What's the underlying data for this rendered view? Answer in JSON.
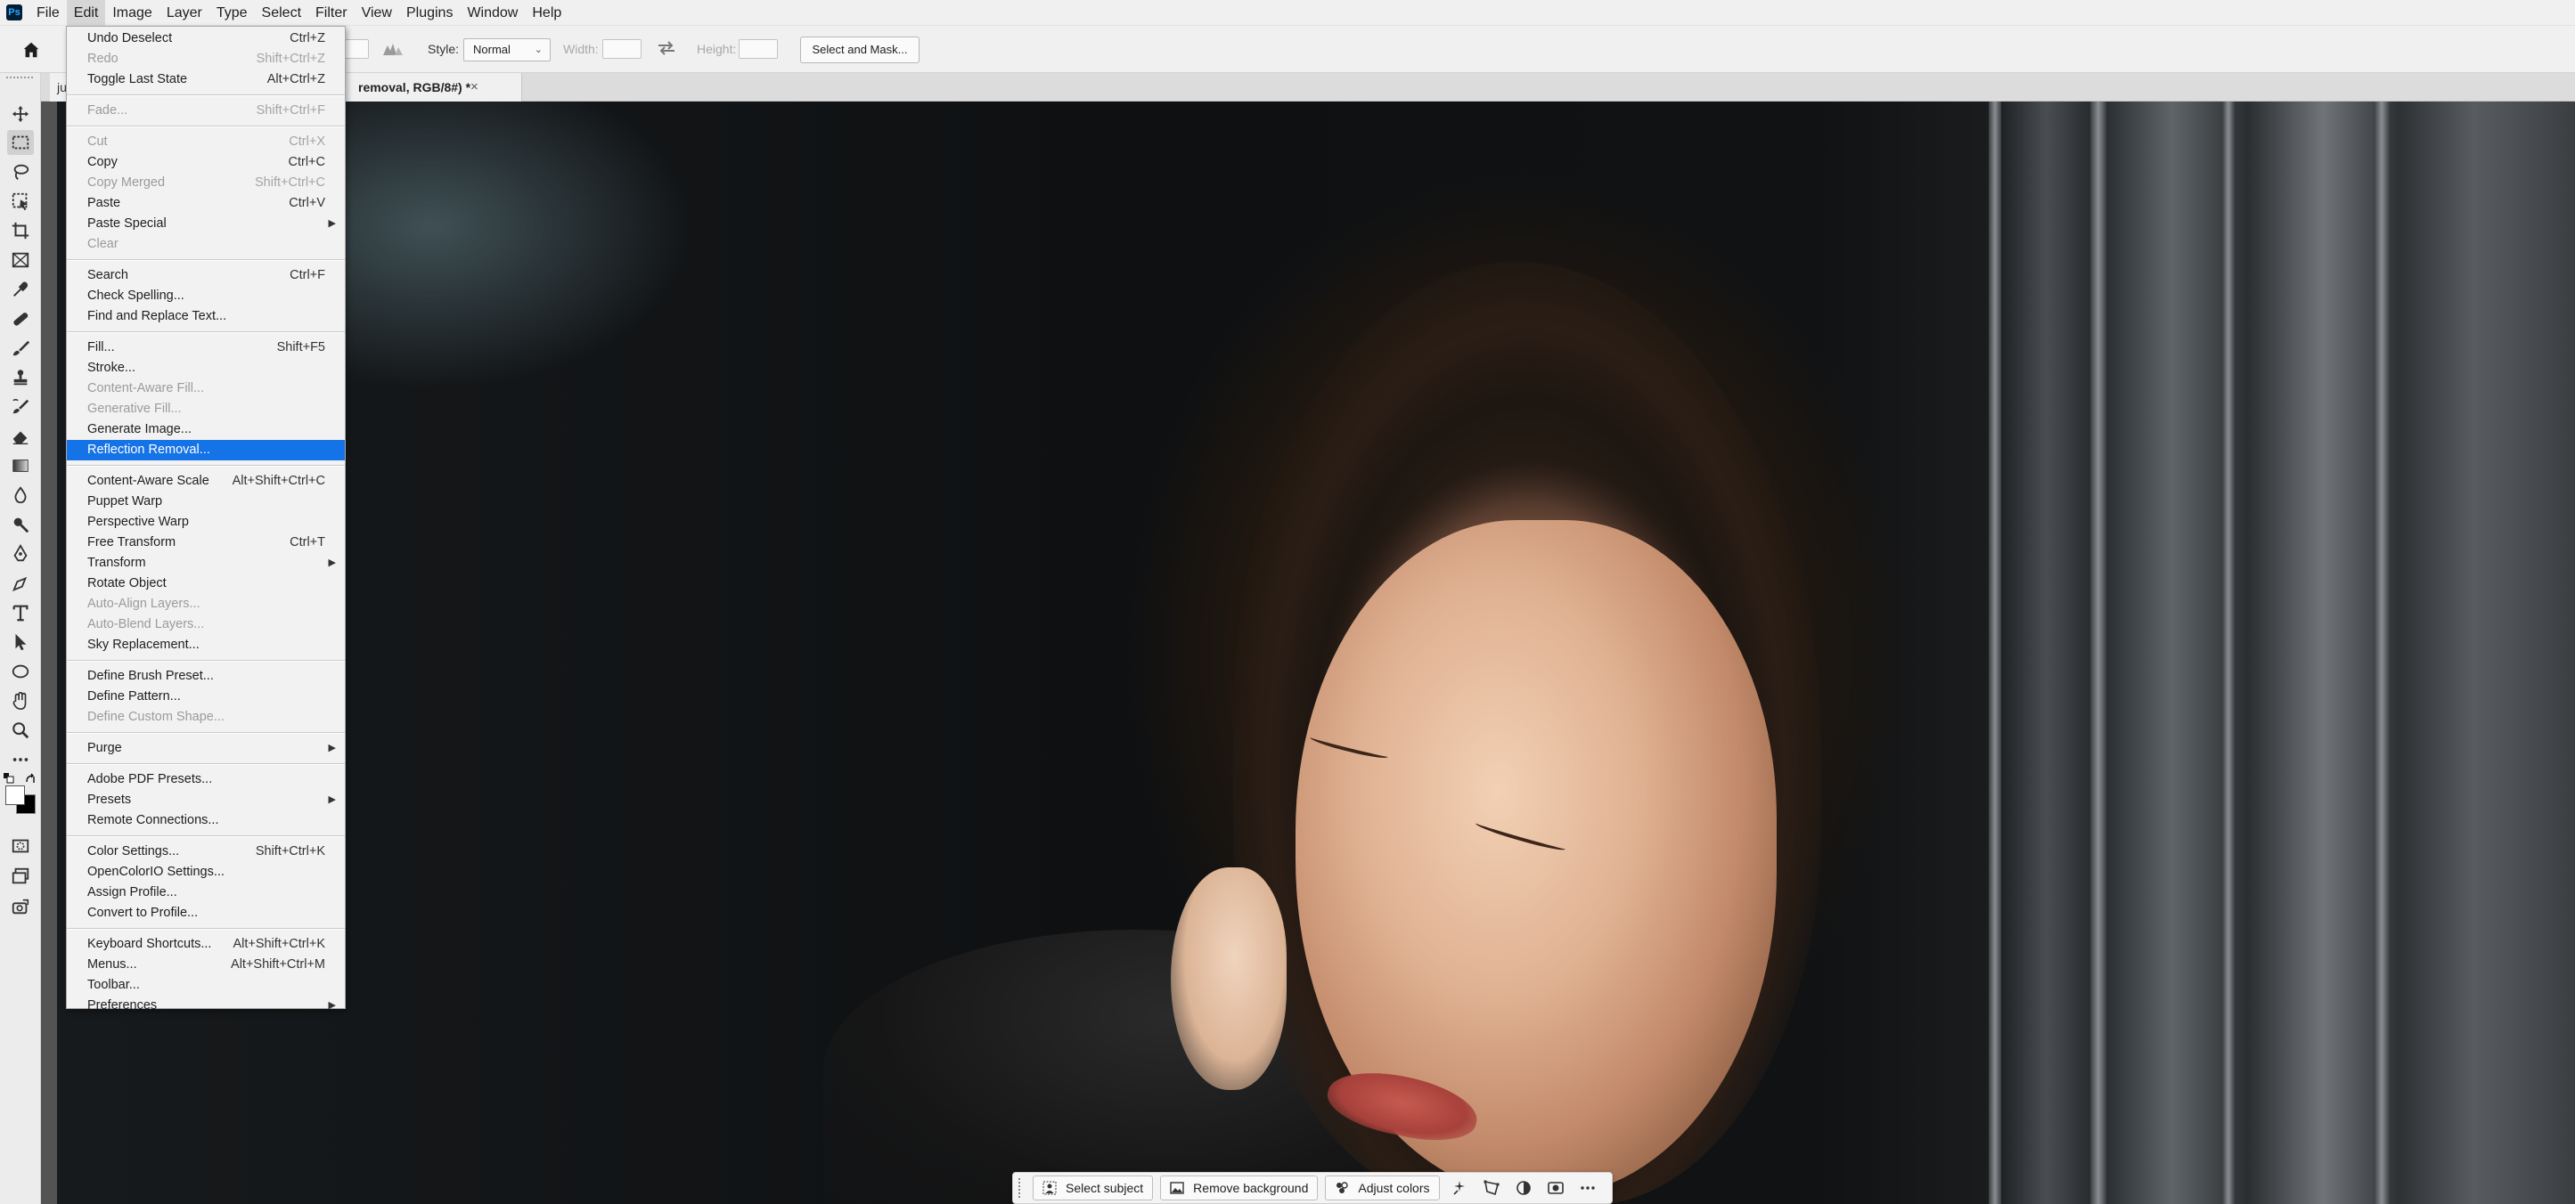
{
  "app": {
    "logo": "Ps",
    "menus": [
      "File",
      "Edit",
      "Image",
      "Layer",
      "Type",
      "Select",
      "Filter",
      "View",
      "Plugins",
      "Window",
      "Help"
    ],
    "active_menu": "Edit"
  },
  "options_bar": {
    "style_label": "Style:",
    "style_value": "Normal",
    "width_label": "Width:",
    "height_label": "Height:",
    "select_mask_label": "Select and Mask..."
  },
  "document": {
    "tab_start": "ju",
    "tab_title": "removal, RGB/8#) *",
    "close_glyph": "×"
  },
  "edit_menu": [
    {
      "label": "Undo Deselect",
      "shortcut": "Ctrl+Z"
    },
    {
      "label": "Redo",
      "shortcut": "Shift+Ctrl+Z",
      "disabled": true
    },
    {
      "label": "Toggle Last State",
      "shortcut": "Alt+Ctrl+Z"
    },
    {
      "sep": true
    },
    {
      "label": "Fade...",
      "shortcut": "Shift+Ctrl+F",
      "disabled": true
    },
    {
      "sep": true
    },
    {
      "label": "Cut",
      "shortcut": "Ctrl+X",
      "disabled": true
    },
    {
      "label": "Copy",
      "shortcut": "Ctrl+C"
    },
    {
      "label": "Copy Merged",
      "shortcut": "Shift+Ctrl+C",
      "disabled": true
    },
    {
      "label": "Paste",
      "shortcut": "Ctrl+V"
    },
    {
      "label": "Paste Special",
      "submenu": true
    },
    {
      "label": "Clear",
      "disabled": true
    },
    {
      "sep": true
    },
    {
      "label": "Search",
      "shortcut": "Ctrl+F"
    },
    {
      "label": "Check Spelling..."
    },
    {
      "label": "Find and Replace Text..."
    },
    {
      "sep": true
    },
    {
      "label": "Fill...",
      "shortcut": "Shift+F5"
    },
    {
      "label": "Stroke..."
    },
    {
      "label": "Content-Aware Fill...",
      "disabled": true
    },
    {
      "label": "Generative Fill...",
      "disabled": true
    },
    {
      "label": "Generate Image..."
    },
    {
      "label": "Reflection Removal...",
      "highlighted": true
    },
    {
      "sep": true
    },
    {
      "label": "Content-Aware Scale",
      "shortcut": "Alt+Shift+Ctrl+C"
    },
    {
      "label": "Puppet Warp"
    },
    {
      "label": "Perspective Warp"
    },
    {
      "label": "Free Transform",
      "shortcut": "Ctrl+T"
    },
    {
      "label": "Transform",
      "submenu": true
    },
    {
      "label": "Rotate Object"
    },
    {
      "label": "Auto-Align Layers...",
      "disabled": true
    },
    {
      "label": "Auto-Blend Layers...",
      "disabled": true
    },
    {
      "label": "Sky Replacement..."
    },
    {
      "sep": true
    },
    {
      "label": "Define Brush Preset..."
    },
    {
      "label": "Define Pattern..."
    },
    {
      "label": "Define Custom Shape...",
      "disabled": true
    },
    {
      "sep": true
    },
    {
      "label": "Purge",
      "submenu": true
    },
    {
      "sep": true
    },
    {
      "label": "Adobe PDF Presets..."
    },
    {
      "label": "Presets",
      "submenu": true
    },
    {
      "label": "Remote Connections..."
    },
    {
      "sep": true
    },
    {
      "label": "Color Settings...",
      "shortcut": "Shift+Ctrl+K"
    },
    {
      "label": "OpenColorIO Settings..."
    },
    {
      "label": "Assign Profile..."
    },
    {
      "label": "Convert to Profile..."
    },
    {
      "sep": true
    },
    {
      "label": "Keyboard Shortcuts...",
      "shortcut": "Alt+Shift+Ctrl+K"
    },
    {
      "label": "Menus...",
      "shortcut": "Alt+Shift+Ctrl+M"
    },
    {
      "label": "Toolbar..."
    },
    {
      "label": "Preferences",
      "submenu": true
    }
  ],
  "taskbar": {
    "select_subject": "Select subject",
    "remove_background": "Remove background",
    "adjust_colors": "Adjust colors"
  },
  "colors": {
    "accent": "#1473e6",
    "menubar_bg": "#f0f0f0",
    "canvas_bg": "#535353"
  }
}
